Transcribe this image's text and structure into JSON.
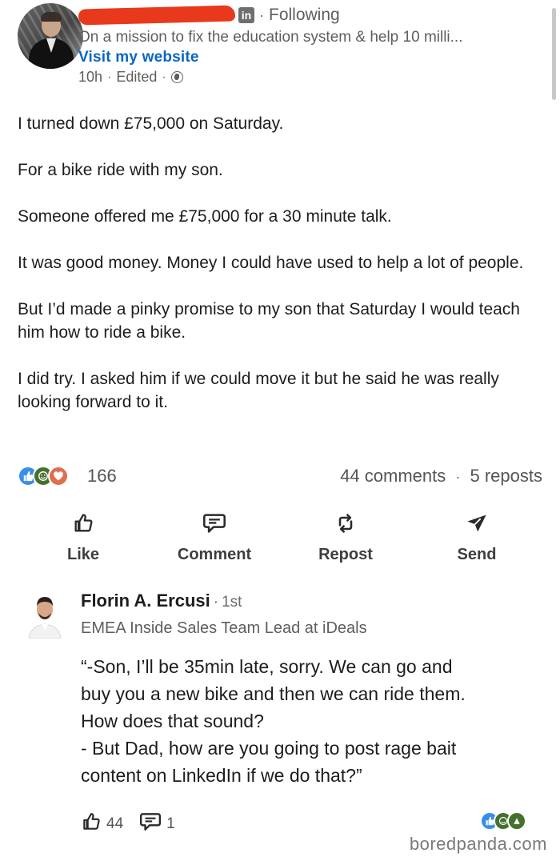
{
  "post": {
    "author_redacted": true,
    "network_badge": "in",
    "following": "Following",
    "headline": "On a mission to fix the education system & help 10 milli...",
    "website_link": "Visit my website",
    "time": "10h",
    "edited": "Edited",
    "visibility_icon": "globe-icon",
    "paragraphs": [
      "I turned down £75,000 on Saturday.",
      "For a bike ride with my son.",
      "Someone offered me £75,000 for a 30 minute talk.",
      "It was good money. Money I could have used to help a lot of people.",
      "But I’d made a pinky promise to my son that Saturday I would teach him how to ride a bike.",
      "I did try. I asked him if we could move it but he said he was really looking forward to it."
    ],
    "reaction_count": "166",
    "comments_count": "44 comments",
    "reposts_count": "5 reposts",
    "reaction_icons": [
      "like-reaction",
      "celebrate-reaction",
      "love-reaction"
    ]
  },
  "actions": [
    {
      "label": "Like",
      "icon": "thumbs-up-icon"
    },
    {
      "label": "Comment",
      "icon": "comment-icon"
    },
    {
      "label": "Repost",
      "icon": "repost-icon"
    },
    {
      "label": "Send",
      "icon": "send-icon"
    }
  ],
  "comment": {
    "name": "Florin A. Ercusi",
    "degree": "1st",
    "title": "EMEA Inside Sales Team Lead at iDeals",
    "lines": [
      "“-Son, I’ll be 35min late, sorry. We can go and",
      "buy you a new bike and then we can ride them.",
      "How does that sound?",
      "- But Dad, how are you going to post rage bait",
      "content on LinkedIn if we do that?”"
    ],
    "like_count": "44",
    "reply_count": "1"
  },
  "watermark": "boredpanda.com",
  "colors": {
    "link": "#0a66c2",
    "redaction": "#e8391c",
    "like_reaction": "#378fe9",
    "celebrate_reaction": "#44712e",
    "love_reaction": "#df704d"
  }
}
